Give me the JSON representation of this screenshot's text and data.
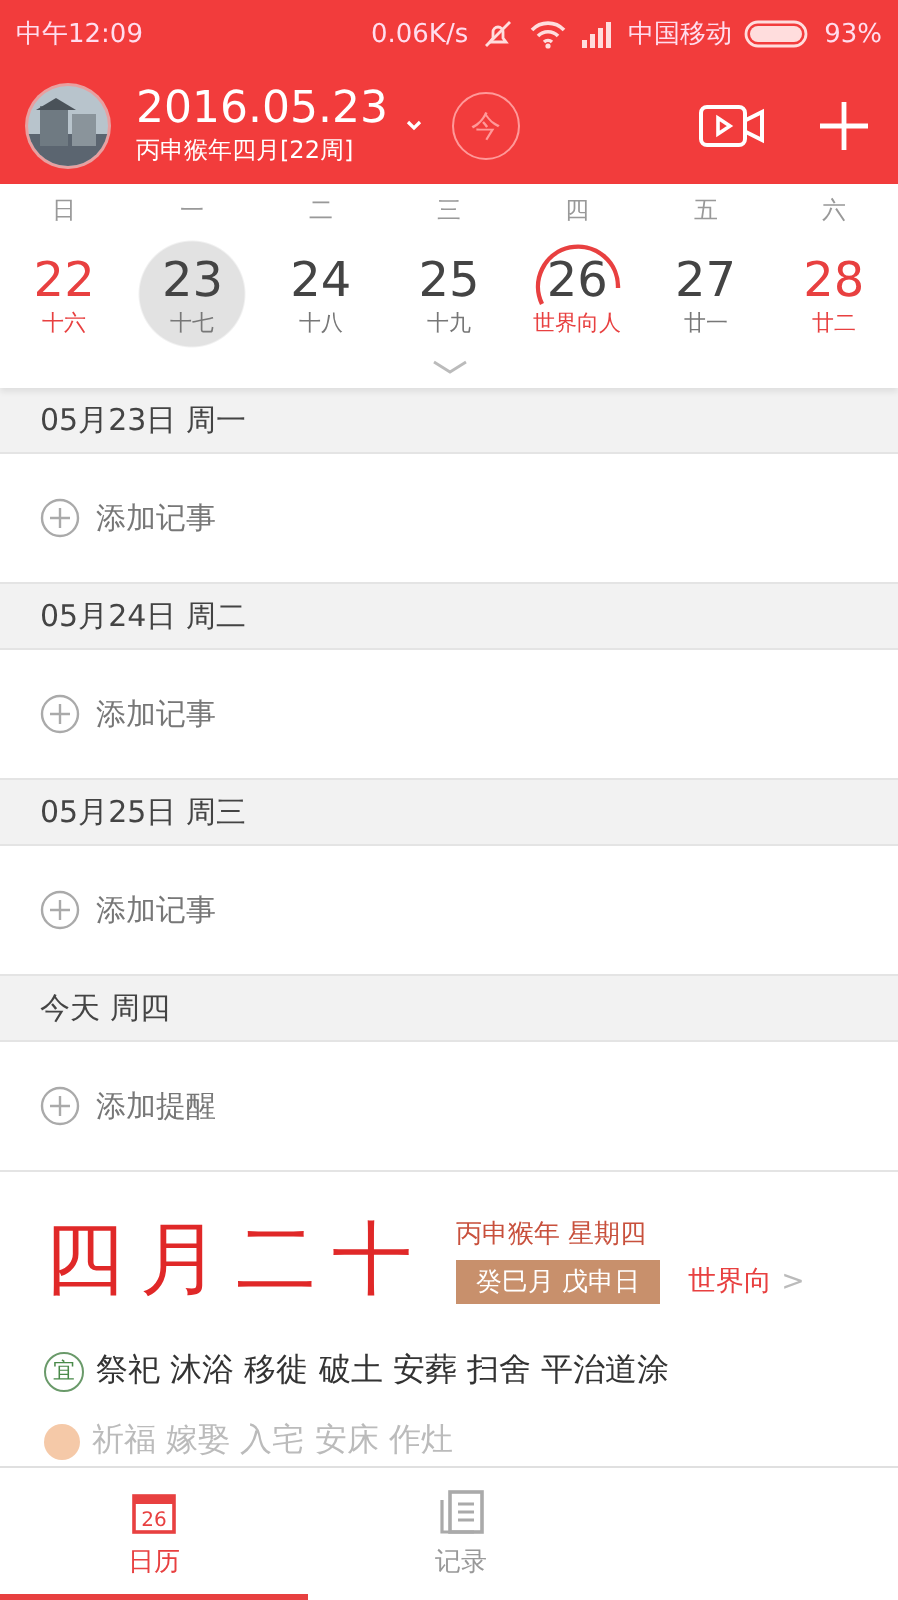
{
  "status_bar": {
    "time": "中午12:09",
    "speed": "0.06K/s",
    "carrier": "中国移动",
    "battery": "93%"
  },
  "header": {
    "date": "2016.05.23",
    "lunar": "丙申猴年四月[22周]",
    "today_button": "今"
  },
  "week": {
    "weekdays": [
      "日",
      "一",
      "二",
      "三",
      "四",
      "五",
      "六"
    ],
    "days": [
      {
        "day": "22",
        "lunar": "十六",
        "weekend": true,
        "selected": false,
        "today": false
      },
      {
        "day": "23",
        "lunar": "十七",
        "weekend": false,
        "selected": true,
        "today": false
      },
      {
        "day": "24",
        "lunar": "十八",
        "weekend": false,
        "selected": false,
        "today": false
      },
      {
        "day": "25",
        "lunar": "十九",
        "weekend": false,
        "selected": false,
        "today": false
      },
      {
        "day": "26",
        "lunar": "世界向人",
        "weekend": false,
        "selected": false,
        "today": true
      },
      {
        "day": "27",
        "lunar": "廿一",
        "weekend": false,
        "selected": false,
        "today": false
      },
      {
        "day": "28",
        "lunar": "廿二",
        "weekend": true,
        "selected": false,
        "today": false
      }
    ]
  },
  "sections": [
    {
      "heading": "05月23日  周一",
      "action": "添加记事"
    },
    {
      "heading": "05月24日  周二",
      "action": "添加记事"
    },
    {
      "heading": "05月25日  周三",
      "action": "添加记事"
    },
    {
      "heading": "今天  周四",
      "action": "添加提醒"
    }
  ],
  "almanac": {
    "lunar_date": "四月二十",
    "year_week": "丙申猴年  星期四",
    "ganzhi": "癸巳月  戊申日",
    "festival": "世界向",
    "festival_arrow": ">",
    "good_mark": "宜",
    "good": "祭祀 沐浴 移徙 破土 安葬 扫舍 平治道涂",
    "bad": "祈福 嫁娶 入宅 安床 作灶"
  },
  "tabs": [
    {
      "label": "日历",
      "icon_text": "26",
      "selected": true
    },
    {
      "label": "记录",
      "selected": false
    }
  ]
}
